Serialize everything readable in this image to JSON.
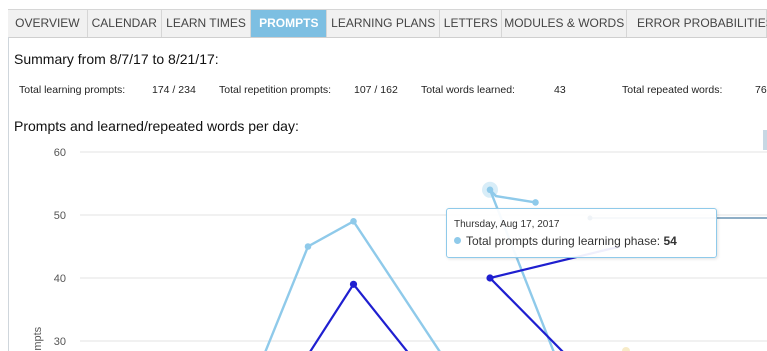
{
  "tabs": [
    {
      "label": "OVERVIEW",
      "active": false
    },
    {
      "label": "CALENDAR",
      "active": false
    },
    {
      "label": "LEARN TIMES",
      "active": false
    },
    {
      "label": "PROMPTS",
      "active": true
    },
    {
      "label": "LEARNING PLANS",
      "active": false
    },
    {
      "label": "LETTERS",
      "active": false
    },
    {
      "label": "MODULES & WORDS",
      "active": false
    },
    {
      "label": "ERROR PROBABILITIES",
      "active": false
    }
  ],
  "summary": {
    "title": "Summary from 8/7/17 to 8/21/17:",
    "stats": [
      {
        "label": "Total learning prompts:",
        "value": "174 / 234"
      },
      {
        "label": "Total repetition prompts:",
        "value": "107 / 162"
      },
      {
        "label": "Total words learned:",
        "value": "43"
      },
      {
        "label": "Total repeated words:",
        "value": "76"
      }
    ]
  },
  "chart_section": {
    "title": "Prompts and learned/repeated words per day:"
  },
  "tooltip": {
    "date": "Thursday, Aug 17, 2017",
    "series": "Total prompts during learning phase:",
    "value": "54"
  },
  "colors": {
    "light_series": "#8fcaea",
    "dark_series": "#1f1fd0",
    "active_tab": "#7dbfe2",
    "grid": "#e3e3e3"
  },
  "chart_data": {
    "type": "line",
    "ylabel": "Prompts",
    "yticks": [
      30,
      40,
      50,
      60
    ],
    "ylim": [
      30,
      60
    ],
    "grid": true,
    "series": [
      {
        "name": "Total prompts during learning phase",
        "color": "#8fcaea",
        "points": [
          {
            "x": "Aug 13, 2017",
            "y": 45
          },
          {
            "x": "Aug 14, 2017",
            "y": 49
          },
          {
            "x": "Aug 17, 2017",
            "y": 54
          },
          {
            "x": "Aug 18, 2017",
            "y": 52
          }
        ]
      },
      {
        "name": "",
        "color": "#1f1fd0",
        "points": [
          {
            "x": "Aug 14, 2017",
            "y": 39
          },
          {
            "x": "Aug 17, 2017",
            "y": 40
          }
        ]
      }
    ]
  }
}
